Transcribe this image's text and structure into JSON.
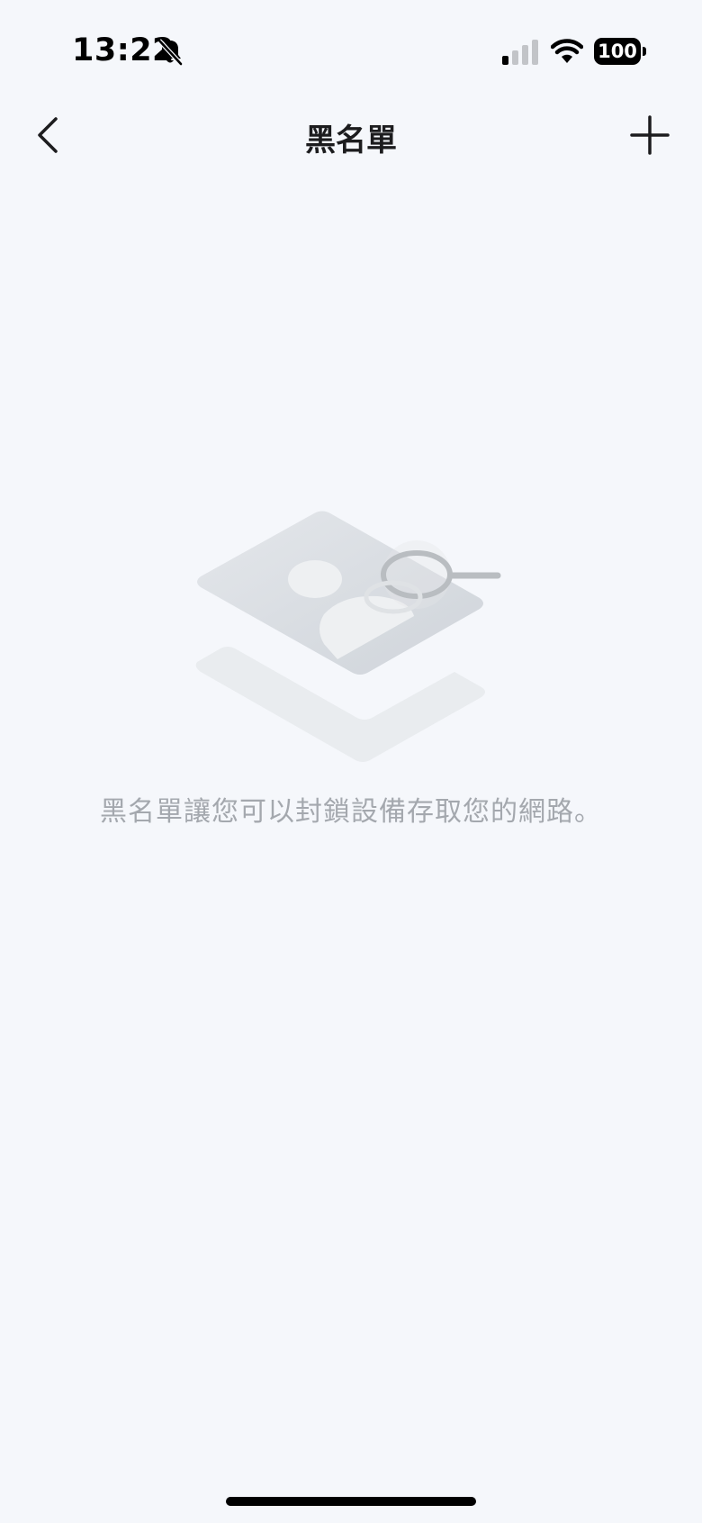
{
  "status_bar": {
    "time": "13:22",
    "battery_level": "100",
    "icons": [
      "bell-off-icon",
      "signal-icon",
      "wifi-icon",
      "battery-icon"
    ]
  },
  "nav": {
    "title": "黑名單",
    "back_icon": "chevron-left-icon",
    "add_icon": "plus-icon"
  },
  "empty_state": {
    "illustration_icon": "empty-blacklist-illustration",
    "message": "黑名單讓您可以封鎖設備存取您的網路。"
  },
  "colors": {
    "background": "#f5f7fb",
    "title": "#1c1c1e",
    "message": "#a4a8ae"
  }
}
